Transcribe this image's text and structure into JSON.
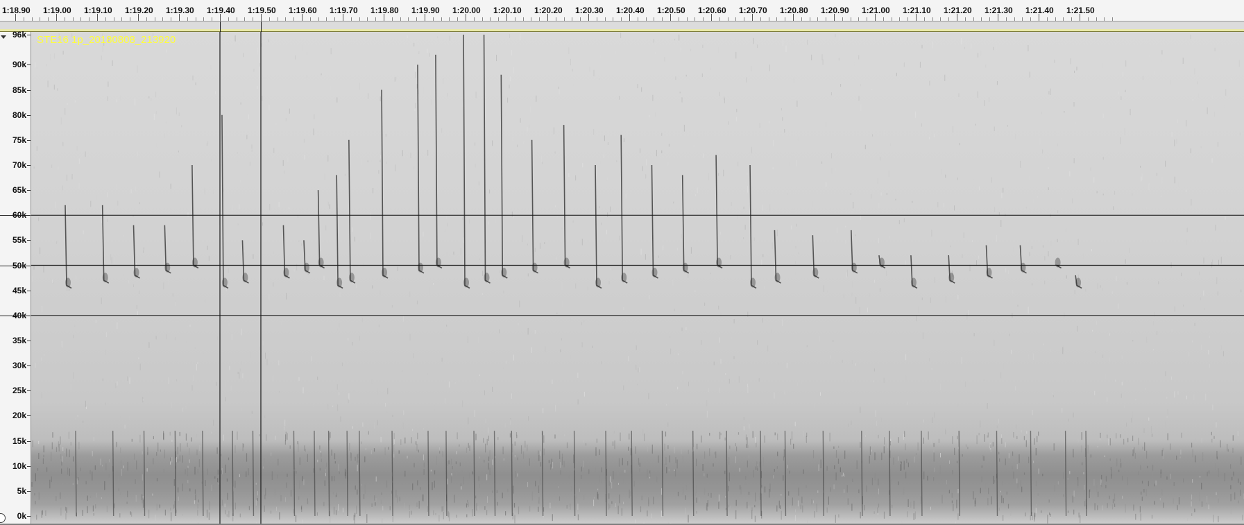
{
  "timeline": {
    "labels": [
      "1:18.90",
      "1:19.00",
      "1:19.10",
      "1:19.20",
      "1:19.30",
      "1:19.40",
      "1:19.50",
      "1:19.60",
      "1:19.70",
      "1:19.80",
      "1:19.90",
      "1:20.00",
      "1:20.10",
      "1:20.20",
      "1:20.30",
      "1:20.40",
      "1:20.50",
      "1:20.60",
      "1:20.70",
      "1:20.80",
      "1:20.90",
      "1:21.00",
      "1:21.10",
      "1:21.20",
      "1:21.30",
      "1:21.40",
      "1:21.50"
    ]
  },
  "track": {
    "name": "STE16 1p_20180808_213920",
    "frequency_labels": [
      "96k",
      "90k",
      "85k",
      "80k",
      "75k",
      "70k",
      "65k",
      "60k",
      "55k",
      "50k",
      "45k",
      "40k",
      "35k",
      "30k",
      "25k",
      "20k",
      "15k",
      "10k",
      "5k",
      "0k"
    ],
    "frequency_values_khz": [
      96,
      90,
      85,
      80,
      75,
      70,
      65,
      60,
      55,
      50,
      45,
      40,
      35,
      30,
      25,
      20,
      15,
      10,
      5,
      0
    ],
    "max_frequency_khz": 96,
    "guide_lines_khz": [
      60,
      50,
      40
    ],
    "selection_time_markers": [
      "1:19.40",
      "1:19.50"
    ]
  },
  "colors": {
    "track_name": "#ffff3a",
    "guide_line": "#1a1a1a",
    "call_ink": "#2a2a2a"
  }
}
